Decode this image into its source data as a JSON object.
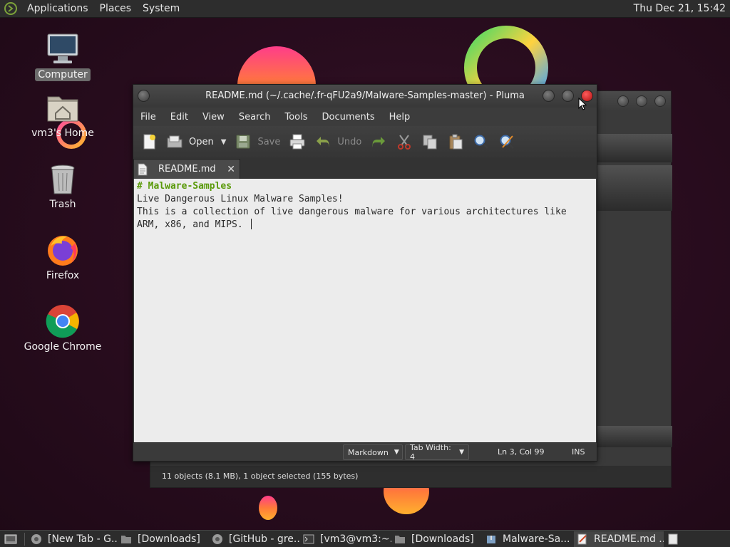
{
  "top_panel": {
    "menus": [
      "Applications",
      "Places",
      "System"
    ],
    "clock": "Thu Dec 21, 15:42"
  },
  "desktop": {
    "icons": [
      {
        "label": "Computer",
        "icon": "computer-icon",
        "selected": true
      },
      {
        "label": "vm3's Home",
        "icon": "home-folder-icon",
        "selected": false
      },
      {
        "label": "Trash",
        "icon": "trash-icon",
        "selected": false
      },
      {
        "label": "Firefox",
        "icon": "firefox-icon",
        "selected": false
      },
      {
        "label": "Google Chrome",
        "icon": "chrome-icon",
        "selected": false
      }
    ]
  },
  "background_window": {
    "status": "11 objects (8.1 MB), 1 object selected (155 bytes)"
  },
  "pluma": {
    "title": "README.md (~/.cache/.fr-qFU2a9/Malware-Samples-master) - Pluma",
    "menu": [
      "File",
      "Edit",
      "View",
      "Search",
      "Tools",
      "Documents",
      "Help"
    ],
    "toolbar": {
      "open_label": "Open",
      "save_label": "Save",
      "undo_label": "Undo"
    },
    "tab_label": "README.md",
    "editor_lines": [
      "# Malware-Samples",
      "Live Dangerous Linux Malware Samples!",
      "This is a collection of live dangerous malware for various architectures like",
      "ARM, x86, and MIPS. "
    ],
    "statusbar": {
      "language": "Markdown",
      "tab_width": "Tab Width:  4",
      "position": "Ln 3, Col 99",
      "mode": "INS"
    }
  },
  "taskbar": {
    "items": [
      {
        "label": "[New Tab - G...",
        "icon": "chrome-icon"
      },
      {
        "label": "[Downloads]",
        "icon": "folder-icon"
      },
      {
        "label": "[GitHub - gre...",
        "icon": "chrome-icon"
      },
      {
        "label": "[vm3@vm3:~...",
        "icon": "terminal-icon"
      },
      {
        "label": "[Downloads]",
        "icon": "folder-icon"
      },
      {
        "label": "Malware-Sa...",
        "icon": "archive-icon"
      },
      {
        "label": "README.md ...",
        "icon": "text-editor-icon"
      }
    ]
  }
}
